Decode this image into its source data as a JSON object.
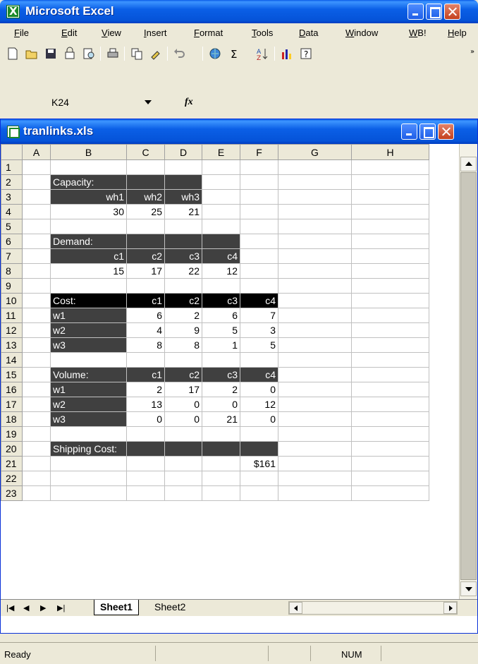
{
  "app": {
    "title": "Microsoft Excel",
    "icon": "excel-icon"
  },
  "menu": [
    "File",
    "Edit",
    "View",
    "Insert",
    "Format",
    "Tools",
    "Data",
    "Window",
    "WB!",
    "Help"
  ],
  "toolbar": {
    "icons": [
      "new-document-icon",
      "open-folder-icon",
      "save-icon",
      "permission-icon",
      "print-preview-icon",
      "print-icon",
      "copy-icon",
      "format-painter-icon",
      "undo-icon",
      "hyperlink-icon",
      "autosum-icon",
      "sort-ascending-icon",
      "chart-wizard-icon",
      "help-icon"
    ]
  },
  "formula_bar": {
    "name_box": "K24",
    "fx_label": "fx",
    "formula": ""
  },
  "workbook": {
    "title": "tranlinks.xls"
  },
  "sheet": {
    "columns": [
      "A",
      "B",
      "C",
      "D",
      "E",
      "F",
      "G",
      "H"
    ],
    "rows": [
      {
        "n": "1",
        "cells": [
          "",
          "",
          "",
          "",
          "",
          "",
          "",
          ""
        ]
      },
      {
        "n": "2",
        "cells": [
          "",
          "Capacity:",
          "",
          "",
          "",
          "",
          "",
          ""
        ]
      },
      {
        "n": "3",
        "cells": [
          "",
          "wh1",
          "wh2",
          "wh3",
          "",
          "",
          "",
          ""
        ]
      },
      {
        "n": "4",
        "cells": [
          "",
          "30",
          "25",
          "21",
          "",
          "",
          "",
          ""
        ]
      },
      {
        "n": "5",
        "cells": [
          "",
          "",
          "",
          "",
          "",
          "",
          "",
          ""
        ]
      },
      {
        "n": "6",
        "cells": [
          "",
          "Demand:",
          "",
          "",
          "",
          "",
          "",
          ""
        ]
      },
      {
        "n": "7",
        "cells": [
          "",
          "c1",
          "c2",
          "c3",
          "c4",
          "",
          "",
          ""
        ]
      },
      {
        "n": "8",
        "cells": [
          "",
          "15",
          "17",
          "22",
          "12",
          "",
          "",
          ""
        ]
      },
      {
        "n": "9",
        "cells": [
          "",
          "",
          "",
          "",
          "",
          "",
          "",
          ""
        ]
      },
      {
        "n": "10",
        "cells": [
          "",
          "Cost:",
          "c1",
          "c2",
          "c3",
          "c4",
          "",
          ""
        ]
      },
      {
        "n": "11",
        "cells": [
          "",
          "w1",
          "6",
          "2",
          "6",
          "7",
          "",
          ""
        ]
      },
      {
        "n": "12",
        "cells": [
          "",
          "w2",
          "4",
          "9",
          "5",
          "3",
          "",
          ""
        ]
      },
      {
        "n": "13",
        "cells": [
          "",
          "w3",
          "8",
          "8",
          "1",
          "5",
          "",
          ""
        ]
      },
      {
        "n": "14",
        "cells": [
          "",
          "",
          "",
          "",
          "",
          "",
          "",
          ""
        ]
      },
      {
        "n": "15",
        "cells": [
          "",
          "Volume:",
          "c1",
          "c2",
          "c3",
          "c4",
          "",
          ""
        ]
      },
      {
        "n": "16",
        "cells": [
          "",
          "w1",
          "2",
          "17",
          "2",
          "0",
          "",
          ""
        ]
      },
      {
        "n": "17",
        "cells": [
          "",
          "w2",
          "13",
          "0",
          "0",
          "12",
          "",
          ""
        ]
      },
      {
        "n": "18",
        "cells": [
          "",
          "w3",
          "0",
          "0",
          "21",
          "0",
          "",
          ""
        ]
      },
      {
        "n": "19",
        "cells": [
          "",
          "",
          "",
          "",
          "",
          "",
          "",
          ""
        ]
      },
      {
        "n": "20",
        "cells": [
          "",
          "Shipping Cost:",
          "",
          "",
          "",
          "",
          "",
          ""
        ]
      },
      {
        "n": "21",
        "cells": [
          "",
          "",
          "",
          "",
          "",
          "$161",
          "",
          ""
        ]
      },
      {
        "n": "22",
        "cells": [
          "",
          "",
          "",
          "",
          "",
          "",
          "",
          ""
        ]
      },
      {
        "n": "23",
        "cells": [
          "",
          "",
          "",
          "",
          "",
          "",
          "",
          ""
        ]
      }
    ]
  },
  "tabs": [
    "Sheet1",
    "Sheet2"
  ],
  "active_tab": "Sheet1",
  "status": {
    "left": "Ready",
    "num": "NUM"
  },
  "colors": {
    "title_blue": "#0553d8",
    "header_dark": "#404040",
    "header_black": "#000000"
  }
}
